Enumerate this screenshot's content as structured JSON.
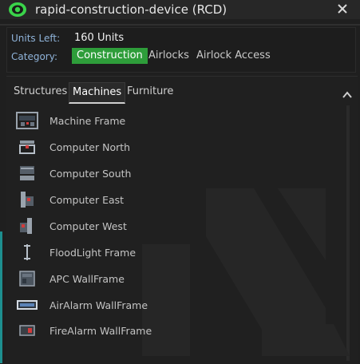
{
  "window": {
    "title": "rapid-construction-device (RCD)"
  },
  "info": {
    "units_label": "Units Left:",
    "units_value": "160 Units",
    "category_label": "Category:",
    "categories": [
      {
        "label": "Construction",
        "active": true
      },
      {
        "label": "Airlocks",
        "active": false
      },
      {
        "label": "Airlock Access",
        "active": false
      }
    ]
  },
  "tabs": [
    {
      "label": "Structures",
      "active": false
    },
    {
      "label": "Machines",
      "active": true
    },
    {
      "label": "Furniture",
      "active": false
    }
  ],
  "items": [
    {
      "label": "Machine Frame",
      "icon": "machine-frame-icon"
    },
    {
      "label": "Computer North",
      "icon": "computer-north-icon"
    },
    {
      "label": "Computer South",
      "icon": "computer-south-icon"
    },
    {
      "label": "Computer East",
      "icon": "computer-east-icon"
    },
    {
      "label": "Computer West",
      "icon": "computer-west-icon"
    },
    {
      "label": "FloodLight Frame",
      "icon": "floodlight-frame-icon"
    },
    {
      "label": "APC WallFrame",
      "icon": "apc-wallframe-icon"
    },
    {
      "label": "AirAlarm WallFrame",
      "icon": "airalarm-wallframe-icon"
    },
    {
      "label": "FireAlarm WallFrame",
      "icon": "firealarm-wallframe-icon"
    }
  ],
  "colors": {
    "accent_green": "#2e9d3a",
    "label_blue": "#8fb3d9",
    "title_eye_green": "#3ad44a"
  }
}
